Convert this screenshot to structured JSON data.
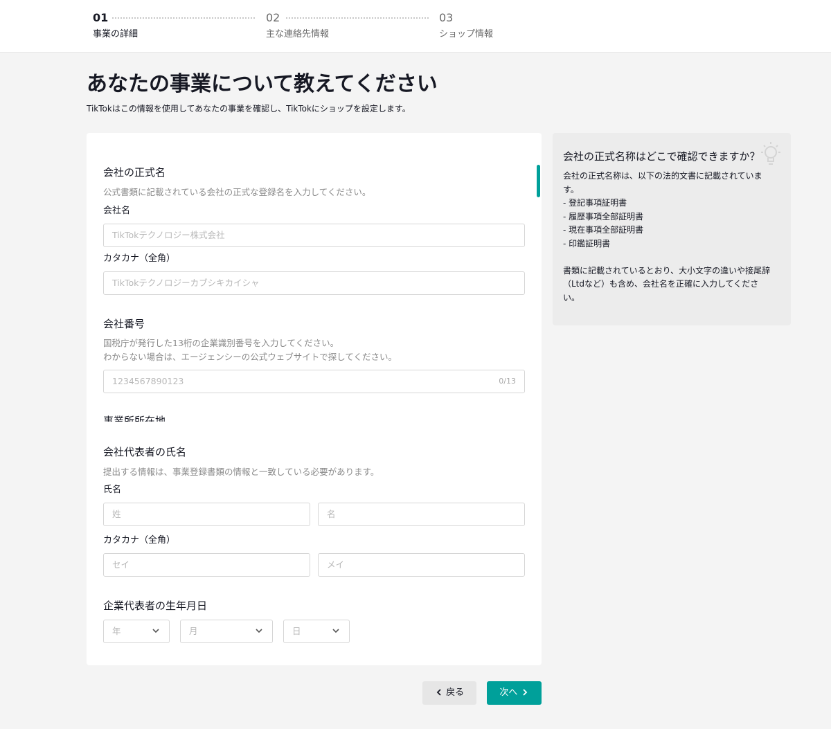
{
  "stepper": {
    "steps": [
      {
        "num": "01",
        "name": "事業の詳細"
      },
      {
        "num": "02",
        "name": "主な連絡先情報"
      },
      {
        "num": "03",
        "name": "ショップ情報"
      }
    ]
  },
  "page": {
    "title": "あなたの事業について教えてください",
    "subtitle": "TikTokはこの情報を使用してあなたの事業を確認し、TikTokにショップを設定します。"
  },
  "form": {
    "company_name": {
      "title": "会社の正式名",
      "hint": "公式書類に記載されている会社の正式な登録名を入力してください。",
      "name_label": "会社名",
      "name_placeholder": "TikTokテクノロジー株式会社",
      "kana_label": "カタカナ（全角）",
      "kana_placeholder": "TikTokテクノロジーカブシキカイシャ"
    },
    "company_number": {
      "title": "会社番号",
      "hint_line1": "国税庁が発行した13桁の企業識別番号を入力してください。",
      "hint_line2": "わからない場合は、エージェンシーの公式ウェブサイトで探してください。",
      "placeholder": "1234567890123",
      "counter": "0/13"
    },
    "address": {
      "title": "事業所所在地"
    },
    "representative": {
      "title": "会社代表者の氏名",
      "hint": "提出する情報は、事業登録書類の情報と一致している必要があります。",
      "name_label": "氏名",
      "last_name_placeholder": "姓",
      "first_name_placeholder": "名",
      "kana_label": "カタカナ（全角）",
      "last_kana_placeholder": "セイ",
      "first_kana_placeholder": "メイ"
    },
    "birthdate": {
      "title": "企業代表者の生年月日",
      "year_placeholder": "年",
      "month_placeholder": "月",
      "day_placeholder": "日"
    }
  },
  "help": {
    "title": "会社の正式名称はどこで確認できますか？",
    "lines": [
      "会社の正式名称は、以下の法的文書に記載されていま",
      "す。",
      "- 登記事項証明書",
      "- 履歴事項全部証明書",
      "- 現在事項全部証明書",
      "- 印鑑証明書",
      "",
      "書類に記載されているとおり、大小文字の違いや接尾辞",
      "（Ltdなど）も含め、会社名を正確に入力してくださ",
      "い。"
    ]
  },
  "footer": {
    "back_label": "戻る",
    "next_label": "次へ"
  },
  "colors": {
    "accent": "#00a09a",
    "background": "#f4f4f4",
    "card": "#ffffff",
    "help_panel": "#ececec"
  }
}
